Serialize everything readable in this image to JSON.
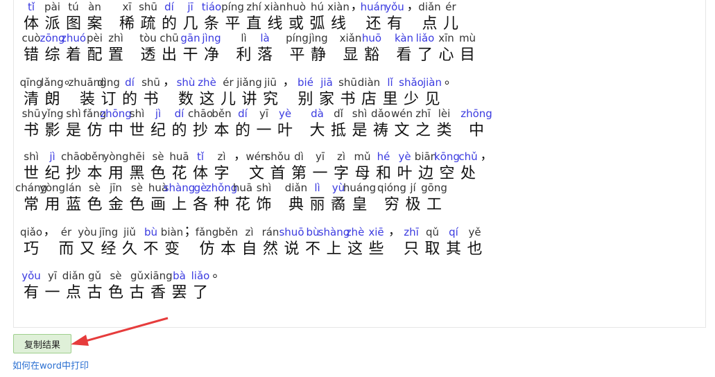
{
  "buttons": {
    "copy_label": "复制结果"
  },
  "links": {
    "print_help": "如何在word中打印"
  },
  "colors": {
    "pinyin_default": "#333333",
    "pinyin_polyphonic": "#3a3ae0",
    "button_bg": "#dff0d8",
    "arrow": "#e63c3c"
  },
  "lines": [
    [
      {
        "h": "体",
        "p": "tǐ",
        "b": true
      },
      {
        "h": "派",
        "p": "pài"
      },
      {
        "h": "图",
        "p": "tú"
      },
      {
        "h": "案",
        "p": "àn"
      },
      {
        "h": "",
        "p": ""
      },
      {
        "h": "稀",
        "p": "xī"
      },
      {
        "h": "疏",
        "p": "shū"
      },
      {
        "h": "的",
        "p": "dí",
        "b": true
      },
      {
        "h": "几",
        "p": "jī",
        "b": true
      },
      {
        "h": "条",
        "p": "tiáo",
        "b": true
      },
      {
        "h": "平",
        "p": "píng"
      },
      {
        "h": "直",
        "p": "zhí"
      },
      {
        "h": "线",
        "p": "xiàn"
      },
      {
        "h": "或",
        "p": "huò"
      },
      {
        "h": "弧",
        "p": "hú"
      },
      {
        "h": "线",
        "p": "xiàn"
      },
      {
        "h": "，",
        "p": ""
      },
      {
        "h": "还",
        "p": "huán",
        "b": true
      },
      {
        "h": "有",
        "p": "yǒu",
        "b": true
      },
      {
        "h": "，",
        "p": ""
      },
      {
        "h": "点",
        "p": "diǎn"
      },
      {
        "h": "儿",
        "p": "ér"
      }
    ],
    [
      {
        "h": "错",
        "p": "cuò"
      },
      {
        "h": "综",
        "p": "zōng",
        "b": true
      },
      {
        "h": "着",
        "p": "zhuó",
        "b": true
      },
      {
        "h": "配",
        "p": "pèi"
      },
      {
        "h": "置",
        "p": "zhì"
      },
      {
        "h": "",
        "p": ""
      },
      {
        "h": "透",
        "p": "tòu"
      },
      {
        "h": "出",
        "p": "chū"
      },
      {
        "h": "干",
        "p": "gān",
        "b": true
      },
      {
        "h": "净",
        "p": "jìng",
        "b": true
      },
      {
        "h": "",
        "p": ""
      },
      {
        "h": "利",
        "p": "lì"
      },
      {
        "h": "落",
        "p": "là",
        "b": true
      },
      {
        "h": "",
        "p": ""
      },
      {
        "h": "平",
        "p": "píng"
      },
      {
        "h": "静",
        "p": "jìng"
      },
      {
        "h": "",
        "p": ""
      },
      {
        "h": "显",
        "p": "xiǎn"
      },
      {
        "h": "豁",
        "p": "huō",
        "b": true
      },
      {
        "h": "",
        "p": ""
      },
      {
        "h": "看",
        "p": "kàn",
        "b": true
      },
      {
        "h": "了",
        "p": "liǎo",
        "b": true
      },
      {
        "h": "心",
        "p": "xīn"
      },
      {
        "h": "目",
        "p": "mù"
      }
    ],
    [
      {
        "h": "清",
        "p": "qīng"
      },
      {
        "h": "朗",
        "p": "lǎng"
      },
      {
        "h": "。",
        "p": ""
      },
      {
        "h": "装",
        "p": "zhuāng"
      },
      {
        "h": "订",
        "p": "dìng"
      },
      {
        "h": "的",
        "p": "dí",
        "b": true
      },
      {
        "h": "书",
        "p": "shū"
      },
      {
        "h": "，",
        "p": ""
      },
      {
        "h": "数",
        "p": "shù",
        "b": true
      },
      {
        "h": "这",
        "p": "zhè",
        "b": true
      },
      {
        "h": "儿",
        "p": "ér"
      },
      {
        "h": "讲",
        "p": "jiǎng"
      },
      {
        "h": "究",
        "p": "jiū"
      },
      {
        "h": "，",
        "p": ""
      },
      {
        "h": "别",
        "p": "bié",
        "b": true
      },
      {
        "h": "家",
        "p": "jiā",
        "b": true
      },
      {
        "h": "书",
        "p": "shū"
      },
      {
        "h": "店",
        "p": "diàn"
      },
      {
        "h": "里",
        "p": "lǐ",
        "b": true
      },
      {
        "h": "少",
        "p": "shǎo",
        "b": true
      },
      {
        "h": "见",
        "p": "jiàn",
        "b": true
      },
      {
        "h": "。",
        "p": ""
      }
    ],
    [
      {
        "h": "书",
        "p": "shū"
      },
      {
        "h": "影",
        "p": "yǐng"
      },
      {
        "h": "是",
        "p": "shì"
      },
      {
        "h": "仿",
        "p": "fǎng"
      },
      {
        "h": "中",
        "p": "zhōng",
        "b": true
      },
      {
        "h": "世",
        "p": "shì"
      },
      {
        "h": "纪",
        "p": "jì",
        "b": true
      },
      {
        "h": "的",
        "p": "dí",
        "b": true
      },
      {
        "h": "抄",
        "p": "chāo"
      },
      {
        "h": "本",
        "p": "běn"
      },
      {
        "h": "的",
        "p": "dí",
        "b": true
      },
      {
        "h": "一",
        "p": "yī"
      },
      {
        "h": "叶",
        "p": "yè",
        "b": true
      },
      {
        "h": "",
        "p": ""
      },
      {
        "h": "大",
        "p": "dà",
        "b": true
      },
      {
        "h": "抵",
        "p": "dǐ"
      },
      {
        "h": "是",
        "p": "shì"
      },
      {
        "h": "祷",
        "p": "dǎo"
      },
      {
        "h": "文",
        "p": "wén"
      },
      {
        "h": "之",
        "p": "zhī"
      },
      {
        "h": "类",
        "p": "lèi"
      },
      {
        "h": "",
        "p": ""
      },
      {
        "h": "中",
        "p": "zhōng",
        "b": true
      }
    ],
    [
      {
        "h": "世",
        "p": "shì"
      },
      {
        "h": "纪",
        "p": "jì",
        "b": true
      },
      {
        "h": "抄",
        "p": "chāo"
      },
      {
        "h": "本",
        "p": "běn"
      },
      {
        "h": "用",
        "p": "yòng"
      },
      {
        "h": "黑",
        "p": "hēi"
      },
      {
        "h": "色",
        "p": "sè"
      },
      {
        "h": "花",
        "p": "huā"
      },
      {
        "h": "体",
        "p": "tǐ",
        "b": true
      },
      {
        "h": "字",
        "p": "zì"
      },
      {
        "h": "，",
        "p": ""
      },
      {
        "h": "文",
        "p": "wén"
      },
      {
        "h": "首",
        "p": "shǒu"
      },
      {
        "h": "第",
        "p": "dì"
      },
      {
        "h": "一",
        "p": "yī"
      },
      {
        "h": "字",
        "p": "zì"
      },
      {
        "h": "母",
        "p": "mǔ"
      },
      {
        "h": "和",
        "p": "hé",
        "b": true
      },
      {
        "h": "叶",
        "p": "yè",
        "b": true
      },
      {
        "h": "边",
        "p": "biān"
      },
      {
        "h": "空",
        "p": "kōng",
        "b": true
      },
      {
        "h": "处",
        "p": "chǔ",
        "b": true
      },
      {
        "h": "，",
        "p": ""
      }
    ],
    [
      {
        "h": "常",
        "p": "cháng"
      },
      {
        "h": "用",
        "p": "yòng"
      },
      {
        "h": "蓝",
        "p": "lán"
      },
      {
        "h": "色",
        "p": "sè"
      },
      {
        "h": "金",
        "p": "jīn"
      },
      {
        "h": "色",
        "p": "sè"
      },
      {
        "h": "画",
        "p": "huà"
      },
      {
        "h": "上",
        "p": "shàng",
        "b": true
      },
      {
        "h": "各",
        "p": "gè",
        "b": true
      },
      {
        "h": "种",
        "p": "zhǒng",
        "b": true
      },
      {
        "h": "花",
        "p": "huā"
      },
      {
        "h": "饰",
        "p": "shì"
      },
      {
        "h": "",
        "p": ""
      },
      {
        "h": "典",
        "p": "diǎn"
      },
      {
        "h": "丽",
        "p": "lì",
        "b": true
      },
      {
        "h": "矞",
        "p": "yù",
        "b": true
      },
      {
        "h": "皇",
        "p": "huáng"
      },
      {
        "h": "",
        "p": ""
      },
      {
        "h": "穷",
        "p": "qióng"
      },
      {
        "h": "极",
        "p": "jí"
      },
      {
        "h": "工",
        "p": "gōng"
      }
    ],
    [
      {
        "h": "巧",
        "p": "qiǎo"
      },
      {
        "h": "，",
        "p": ""
      },
      {
        "h": "而",
        "p": "ér"
      },
      {
        "h": "又",
        "p": "yòu"
      },
      {
        "h": "经",
        "p": "jīng"
      },
      {
        "h": "久",
        "p": "jiǔ"
      },
      {
        "h": "不",
        "p": "bù",
        "b": true
      },
      {
        "h": "变",
        "p": "biàn"
      },
      {
        "h": "；",
        "p": ""
      },
      {
        "h": "仿",
        "p": "fǎng"
      },
      {
        "h": "本",
        "p": "běn"
      },
      {
        "h": "自",
        "p": "zì"
      },
      {
        "h": "然",
        "p": "rán"
      },
      {
        "h": "说",
        "p": "shuō",
        "b": true
      },
      {
        "h": "不",
        "p": "bù",
        "b": true
      },
      {
        "h": "上",
        "p": "shàng",
        "b": true
      },
      {
        "h": "这",
        "p": "zhè",
        "b": true
      },
      {
        "h": "些",
        "p": "xiē",
        "b": true
      },
      {
        "h": "，",
        "p": ""
      },
      {
        "h": "只",
        "p": "zhī",
        "b": true
      },
      {
        "h": "取",
        "p": "qǔ"
      },
      {
        "h": "其",
        "p": "qí",
        "b": true
      },
      {
        "h": "也",
        "p": "yě"
      }
    ],
    [
      {
        "h": "有",
        "p": "yǒu",
        "b": true
      },
      {
        "h": "一",
        "p": "yī"
      },
      {
        "h": "点",
        "p": "diǎn"
      },
      {
        "h": "古",
        "p": "gǔ"
      },
      {
        "h": "色",
        "p": "sè"
      },
      {
        "h": "古",
        "p": "gǔ"
      },
      {
        "h": "香",
        "p": "xiāng"
      },
      {
        "h": "罢",
        "p": "bà",
        "b": true
      },
      {
        "h": "了",
        "p": "liǎo",
        "b": true
      },
      {
        "h": "。",
        "p": ""
      }
    ]
  ]
}
